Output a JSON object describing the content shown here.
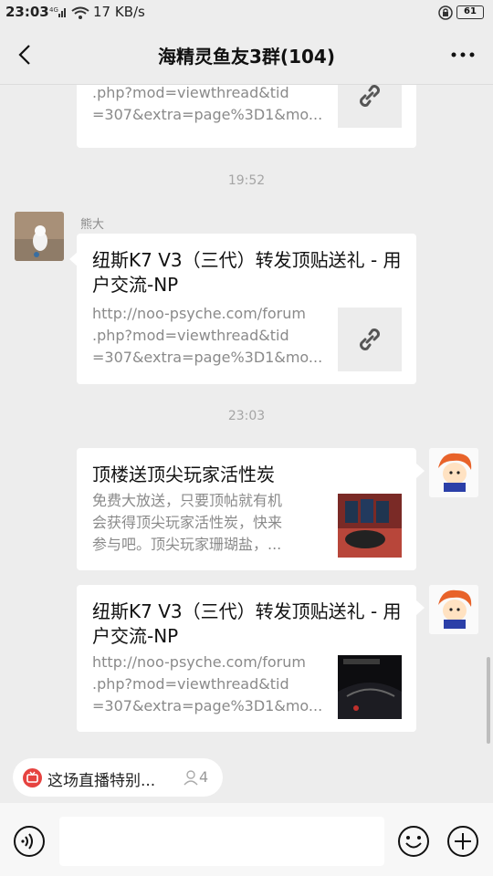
{
  "status_bar": {
    "time": "23:03",
    "network": "4G",
    "speed": "17 KB/s",
    "battery": "61"
  },
  "header": {
    "title": "海精灵鱼友3群(104)"
  },
  "messages": [
    {
      "desc": ".php?mod=viewthread&tid\n=307&extra=page%3D1&mo...",
      "thumb_icon": "link-icon"
    },
    {
      "timestamp": "19:52"
    },
    {
      "sender": "熊大",
      "title": "纽斯K7 V3（三代）转发顶贴送礼 - 用户交流-NP",
      "desc": "http://noo-psyche.com/forum\n.php?mod=viewthread&tid\n=307&extra=page%3D1&mo...",
      "thumb_icon": "link-icon"
    },
    {
      "timestamp": "23:03"
    },
    {
      "title": "顶楼送顶尖玩家活性炭",
      "desc": "免费大放送，只要顶帖就有机\n会获得顶尖玩家活性炭，快来\n参与吧。顶尖玩家珊瑚盐，...",
      "thumb_icon": "product-image"
    },
    {
      "title": "纽斯K7 V3（三代）转发顶贴送礼 - 用户交流-NP",
      "desc": "http://noo-psyche.com/forum\n.php?mod=viewthread&tid\n=307&extra=page%3D1&mo...",
      "thumb_icon": "game-image"
    }
  ],
  "pinned_live": {
    "label": "这场直播特别...",
    "viewers": "4"
  },
  "colors": {
    "background": "#ededed",
    "bubble": "#ffffff",
    "live": "#e64340"
  }
}
